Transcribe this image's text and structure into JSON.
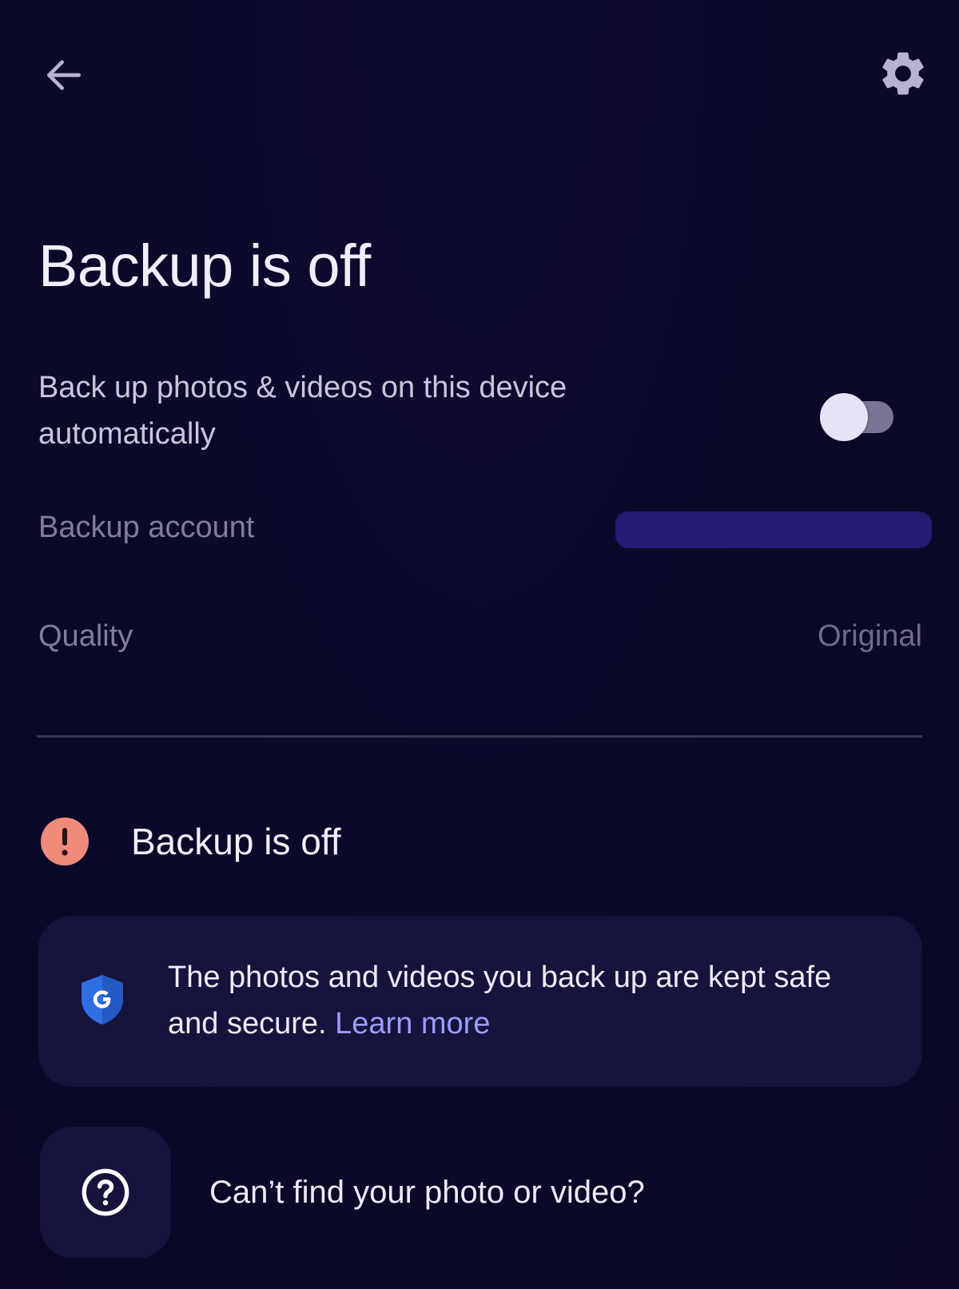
{
  "header": {
    "back_icon": "arrow-left-icon",
    "settings_icon": "gear-icon"
  },
  "page": {
    "title": "Backup is off"
  },
  "backup_toggle": {
    "label": "Back up photos & videos on this device automatically",
    "enabled": false
  },
  "account": {
    "label": "Backup account",
    "value_redacted": true
  },
  "quality": {
    "label": "Quality",
    "value": "Original"
  },
  "status": {
    "icon": "alert-circle-icon",
    "text": "Backup is off",
    "color": "#f08a7a"
  },
  "info_card": {
    "icon": "google-shield-icon",
    "text": "The photos and videos you back up are kept safe and secure.",
    "link_label": "Learn more",
    "link_color": "#9d9cff"
  },
  "help": {
    "icon": "help-circle-icon",
    "text": "Can’t find your photo or video?"
  },
  "colors": {
    "background": "#0b0929",
    "card": "#16133c",
    "account_bar": "#231c72"
  }
}
